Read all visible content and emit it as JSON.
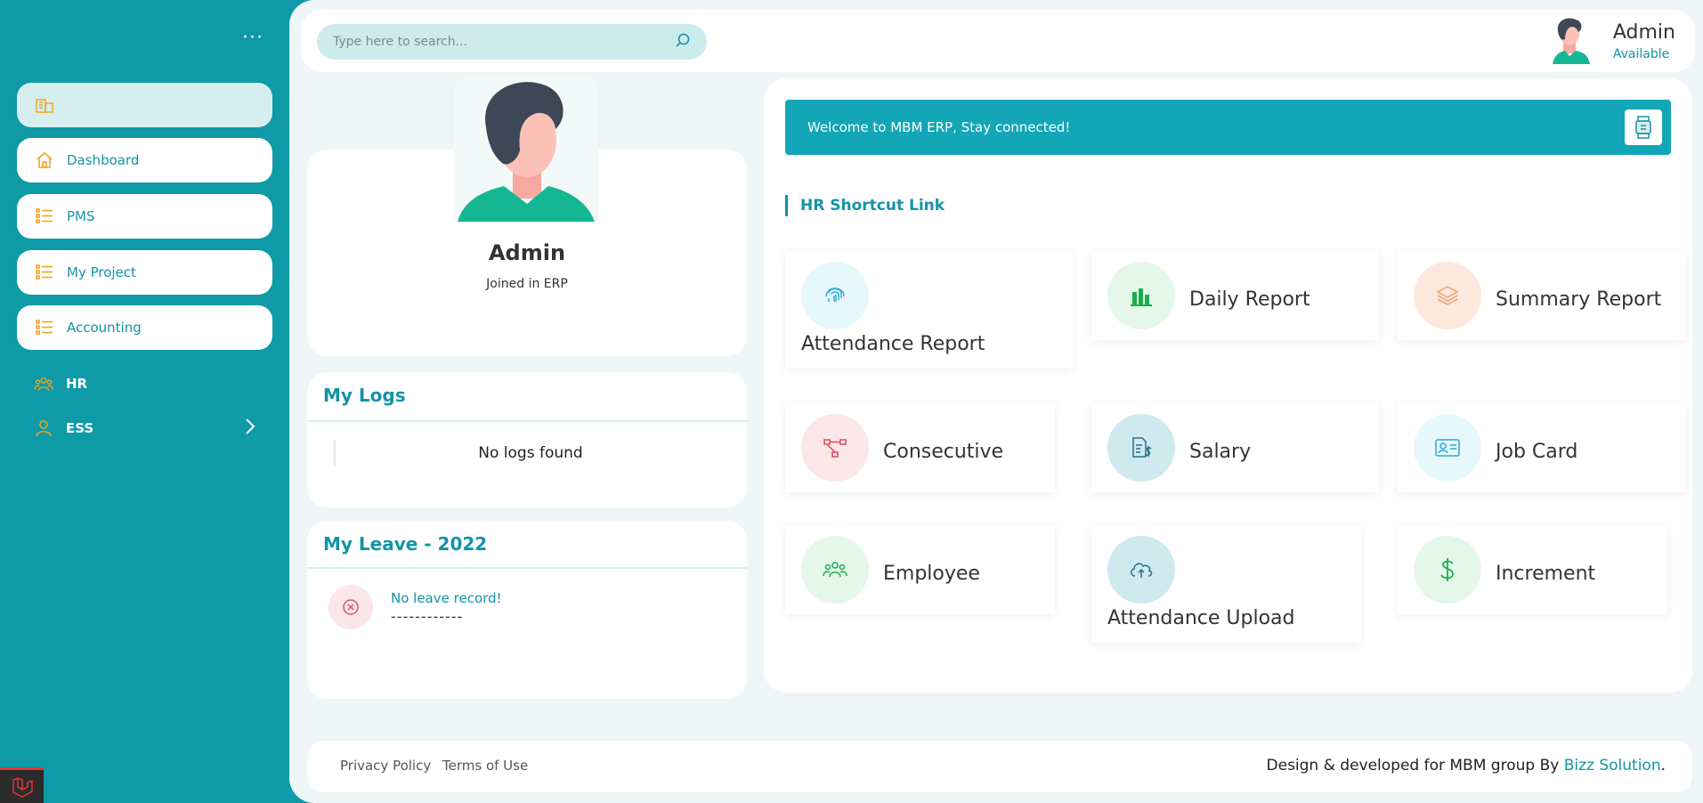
{
  "sidebar": {
    "menu_dots": "···",
    "items": [
      {
        "label": "",
        "icon": "building-icon"
      },
      {
        "label": "Dashboard",
        "icon": "home-icon"
      },
      {
        "label": "PMS",
        "icon": "list-icon"
      },
      {
        "label": "My Project",
        "icon": "list-icon"
      },
      {
        "label": "Accounting",
        "icon": "list-icon"
      }
    ],
    "sections": [
      {
        "label": "HR",
        "icon": "users-icon"
      },
      {
        "label": "ESS",
        "icon": "user-icon"
      }
    ]
  },
  "header": {
    "search_placeholder": "Type here to search...",
    "user_name": "Admin",
    "user_status": "Available"
  },
  "profile": {
    "name": "Admin",
    "subtitle": "Joined in ERP"
  },
  "logs": {
    "title": "My Logs",
    "empty_text": "No logs found"
  },
  "leave": {
    "title": "My Leave - 2022",
    "empty_text": "No leave record!",
    "dashes": "------------"
  },
  "welcome": {
    "message": "Welcome to MBM ERP, Stay connected!"
  },
  "shortcuts": {
    "title": "HR Shortcut Link",
    "items": [
      {
        "label": "Attendance Report",
        "icon": "fingerprint-icon",
        "color": "#e6f8fc"
      },
      {
        "label": "Daily Report",
        "icon": "bar-chart-icon",
        "color": "#e5f7e9"
      },
      {
        "label": "Summary Report",
        "icon": "layers-icon",
        "color": "#fbe9dd"
      },
      {
        "label": "Consecutive",
        "icon": "flowchart-icon",
        "color": "#fbe6e8"
      },
      {
        "label": "Salary",
        "icon": "salary-doc-icon",
        "color": "#cfeaee"
      },
      {
        "label": "Job Card",
        "icon": "id-card-icon",
        "color": "#e6f8fc"
      },
      {
        "label": "Employee",
        "icon": "team-icon",
        "color": "#e5f7e9"
      },
      {
        "label": "Attendance Upload",
        "icon": "cloud-upload-icon",
        "color": "#cfeaee"
      },
      {
        "label": "Increment",
        "icon": "dollar-icon",
        "color": "#e5f7e9"
      }
    ]
  },
  "footer": {
    "privacy": "Privacy Policy",
    "terms": "Terms of Use",
    "credit_prefix": "Design & developed for MBM group By",
    "credit_brand": "Bizz Solution",
    "credit_suffix": "."
  },
  "colors": {
    "primary": "#0e9aa7",
    "accent_text": "#1493a8",
    "sidebar_icon": "#f0a520"
  }
}
